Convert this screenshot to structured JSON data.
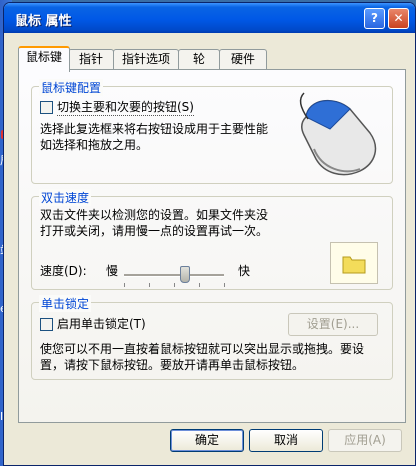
{
  "desktop": {
    "labels": [
      "居",
      "站",
      "e",
      "In"
    ]
  },
  "window": {
    "title": "鼠标 属性",
    "help_icon": "?",
    "close_icon": "✕"
  },
  "tabs": [
    "鼠标键",
    "指针",
    "指针选项",
    "轮",
    "硬件"
  ],
  "button_config": {
    "group_label": "鼠标键配置",
    "checkbox_label": "切换主要和次要的按钮(S)",
    "checked": false,
    "description_line1": "选择此复选框来将右按钮设成用于主要性能",
    "description_line2": "如选择和拖放之用。"
  },
  "double_click": {
    "group_label": "双击速度",
    "description_line1": "双击文件夹以检测您的设置。如果文件夹没",
    "description_line2": "打开或关闭，请用慢一点的设置再试一次。",
    "speed_label": "速度(D):",
    "slow_label": "慢",
    "fast_label": "快",
    "speed_level": 0.6
  },
  "click_lock": {
    "group_label": "单击锁定",
    "checkbox_label": "启用单击锁定(T)",
    "checked": false,
    "settings_button": "设置(E)...",
    "description_line1": "使您可以不用一直按着鼠标按钮就可以突出显示或拖拽。要设",
    "description_line2": "置，请按下鼠标按钮。要放开请再单击鼠标按钮。"
  },
  "footer": {
    "ok": "确定",
    "cancel": "取消",
    "apply": "应用(A)"
  }
}
